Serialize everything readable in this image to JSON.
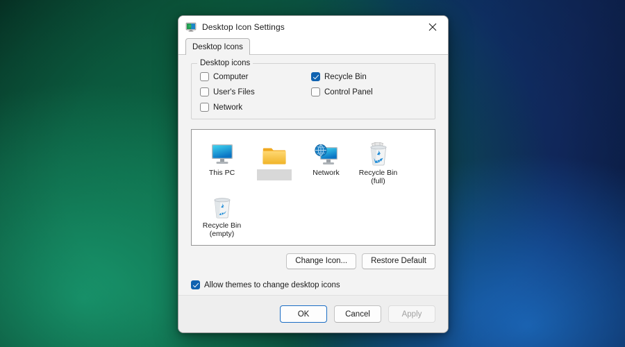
{
  "desktop": {
    "wallpaper_colors": {
      "green_dark": "#04201a",
      "green_mid": "#0b5236",
      "green_bright": "#13795a",
      "blue_dark": "#0b1d45",
      "blue_mid": "#0e2f63",
      "blue_bright": "#1457a0"
    }
  },
  "window": {
    "title": "Desktop Icon Settings",
    "title_icon": "desktop-monitor-icon",
    "close_icon": "close-icon",
    "accent_color": "#0f62b0"
  },
  "tabs": [
    {
      "label": "Desktop Icons",
      "selected": true
    }
  ],
  "group": {
    "legend": "Desktop icons",
    "checkboxes": [
      {
        "label": "Computer",
        "checked": false,
        "column": 1
      },
      {
        "label": "Recycle Bin",
        "checked": true,
        "column": 2
      },
      {
        "label": "User's Files",
        "checked": false,
        "column": 1
      },
      {
        "label": "Control Panel",
        "checked": false,
        "column": 2
      },
      {
        "label": "Network",
        "checked": false,
        "column": 1
      }
    ]
  },
  "preview": {
    "icons": [
      {
        "label": "This PC",
        "icon": "monitor-icon",
        "blank_label": false
      },
      {
        "label": "",
        "icon": "folder-icon",
        "blank_label": true
      },
      {
        "label": "Network",
        "icon": "network-globe-monitor-icon",
        "blank_label": false
      },
      {
        "label": "Recycle Bin\n(full)",
        "icon": "recycle-bin-full-icon",
        "blank_label": false
      },
      {
        "label": "Recycle Bin\n(empty)",
        "icon": "recycle-bin-empty-icon",
        "blank_label": false
      }
    ]
  },
  "icon_buttons": {
    "change_icon": "Change Icon...",
    "restore_default": "Restore Default"
  },
  "allow_themes": {
    "label": "Allow themes to change desktop icons",
    "checked": true
  },
  "footer": {
    "ok": "OK",
    "cancel": "Cancel",
    "apply": "Apply",
    "apply_enabled": false,
    "ok_is_default": true
  }
}
